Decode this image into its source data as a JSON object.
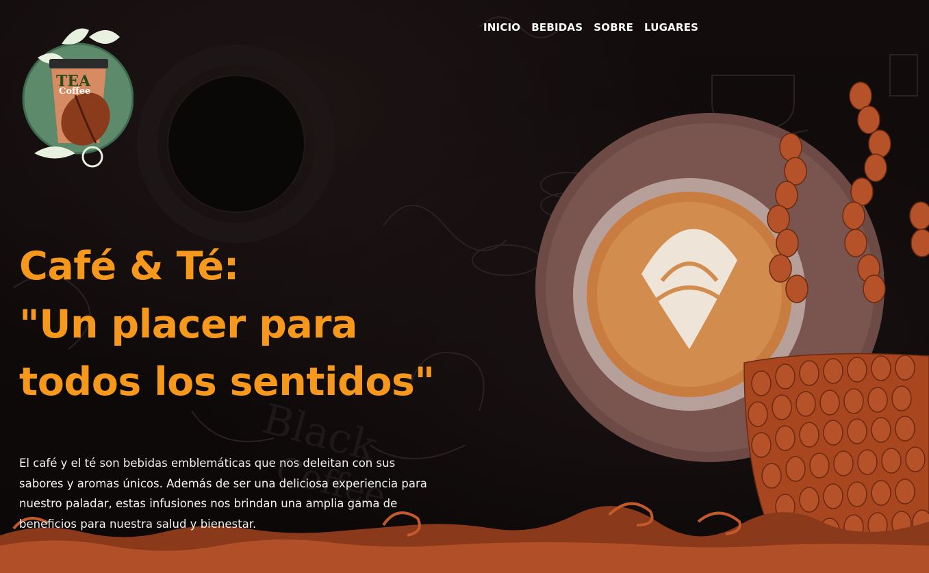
{
  "logo": {
    "brand_top": "TEA",
    "brand_bottom": "Coffee"
  },
  "nav": {
    "items": [
      {
        "label": "INICIO"
      },
      {
        "label": "BEBIDAS"
      },
      {
        "label": "SOBRE"
      },
      {
        "label": "LUGARES"
      }
    ]
  },
  "hero": {
    "title_line1": "Café & Té:",
    "title_line2": "\"Un placer para todos los sentidos\"",
    "description": "El café y el té son bebidas emblemáticas que nos deleitan con sus sabores y aromas únicos. Además de ser una deliciosa experiencia para nuestro paladar, estas infusiones nos brindan una amplia gama de beneficios para nuestra salud y bienestar."
  },
  "colors": {
    "accent": "#f5981b",
    "background": "#0d0909",
    "bean": "#b5522a",
    "cup": "#6e4a46",
    "logo_circle": "#5d8a6a"
  }
}
